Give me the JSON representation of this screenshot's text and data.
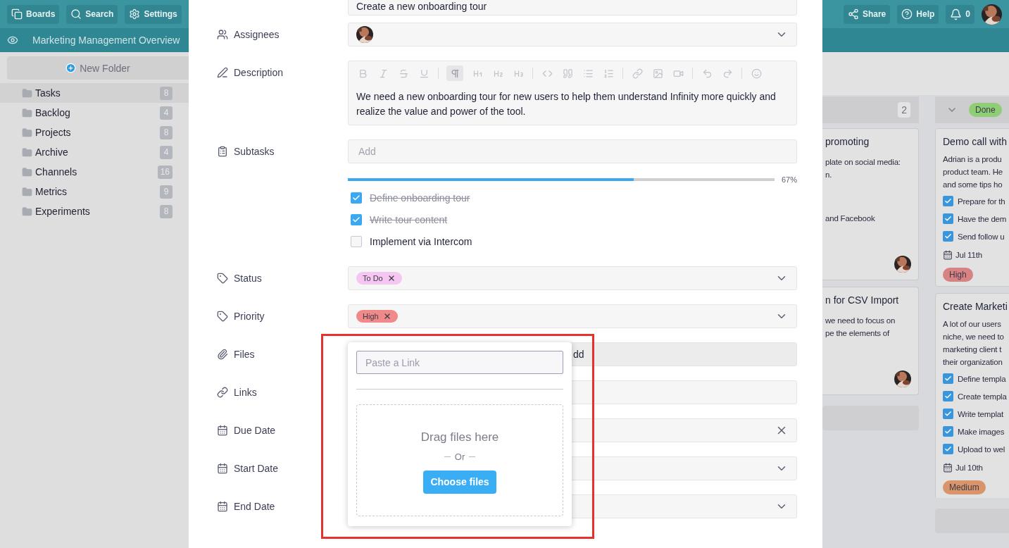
{
  "topbar": {
    "left_buttons": [
      {
        "kind": "boards",
        "label": "Boards"
      },
      {
        "kind": "search",
        "label": "Search"
      },
      {
        "kind": "settings",
        "label": "Settings"
      }
    ],
    "right_buttons": [
      {
        "kind": "share",
        "label": "Share"
      },
      {
        "kind": "help",
        "label": "Help"
      }
    ],
    "notifications": "0"
  },
  "subbar": {
    "title": "Marketing Management Overview"
  },
  "sidebar": {
    "new_folder": "New Folder",
    "items": [
      {
        "label": "Tasks",
        "count": "8",
        "selected": true
      },
      {
        "label": "Backlog",
        "count": "4",
        "selected": false
      },
      {
        "label": "Projects",
        "count": "8",
        "selected": false
      },
      {
        "label": "Archive",
        "count": "4",
        "selected": false
      },
      {
        "label": "Channels",
        "count": "16",
        "selected": false
      },
      {
        "label": "Metrics",
        "count": "9",
        "selected": false
      },
      {
        "label": "Experiments",
        "count": "8",
        "selected": false
      }
    ]
  },
  "board": {
    "columns": [
      {
        "kind": "partial",
        "count": "2",
        "cards": [
          {
            "title": "promoting",
            "paragraphs": [
              [
                "plate on social media:",
                "n."
              ],
              [
                "and Facebook"
              ]
            ]
          },
          {
            "title": "n for CSV Import",
            "paragraphs": [
              [
                "we need to focus on",
                "pe the elements of"
              ]
            ]
          }
        ]
      },
      {
        "kind": "full",
        "tag": {
          "text": "Done",
          "color": "#8fce77"
        },
        "cards": [
          {
            "title": "Demo call with",
            "description": [
              "Adrian is a produ",
              "product team. He",
              "and some tips ho"
            ],
            "checklist": [
              {
                "text": "Prepare for th",
                "checked": true
              },
              {
                "text": "Have the dem",
                "checked": true
              },
              {
                "text": "Send follow u",
                "checked": true
              }
            ],
            "date": "Jul 11th",
            "tag": {
              "text": "High",
              "color": "#d78383"
            }
          },
          {
            "title": "Create Marketi",
            "description": [
              "A lot of our users",
              "niche, we need to",
              "marketing client t",
              "their organization"
            ],
            "checklist": [
              {
                "text": "Define templa",
                "checked": true
              },
              {
                "text": "Create templa",
                "checked": true
              },
              {
                "text": "Write templat",
                "checked": true
              },
              {
                "text": "Make images",
                "checked": true
              },
              {
                "text": "Upload to wel",
                "checked": true
              }
            ],
            "date": "Jul 10th",
            "tag": {
              "text": "Medium",
              "color": "#d9946c"
            }
          }
        ]
      }
    ]
  },
  "modal": {
    "title_value": "Create a new onboarding tour",
    "fields": [
      {
        "kind": "assignees",
        "label": "Assignees"
      },
      {
        "kind": "description",
        "label": "Description",
        "text": "We need a new onboarding tour for new users to help them understand Infinity more quickly and realize the value and power of the tool."
      },
      {
        "kind": "subtasks",
        "label": "Subtasks",
        "placeholder": "Add",
        "level": 0.67,
        "percent": "67%",
        "items": [
          {
            "text": "Define onboarding tour",
            "checked": true
          },
          {
            "text": "Write tour content",
            "checked": true
          },
          {
            "text": "Implement via Intercom",
            "checked": false
          }
        ]
      },
      {
        "kind": "tags",
        "label": "Status",
        "tags": [
          {
            "text": "To Do",
            "color": "#f5c6f1"
          }
        ]
      },
      {
        "kind": "tags",
        "label": "Priority",
        "tags": [
          {
            "text": "High",
            "color": "#f08a8a"
          }
        ]
      },
      {
        "kind": "files",
        "label": "Files",
        "value": "dd",
        "popover": {
          "placeholder": "Paste a Link",
          "drop_text": "Drag files here",
          "or_text": "Or",
          "button": "Choose files"
        }
      },
      {
        "kind": "links",
        "label": "Links"
      },
      {
        "kind": "date",
        "label": "Due Date",
        "clearable": true
      },
      {
        "kind": "date",
        "label": "Start Date",
        "clearable": false
      },
      {
        "kind": "date",
        "label": "End Date",
        "clearable": false
      }
    ]
  }
}
